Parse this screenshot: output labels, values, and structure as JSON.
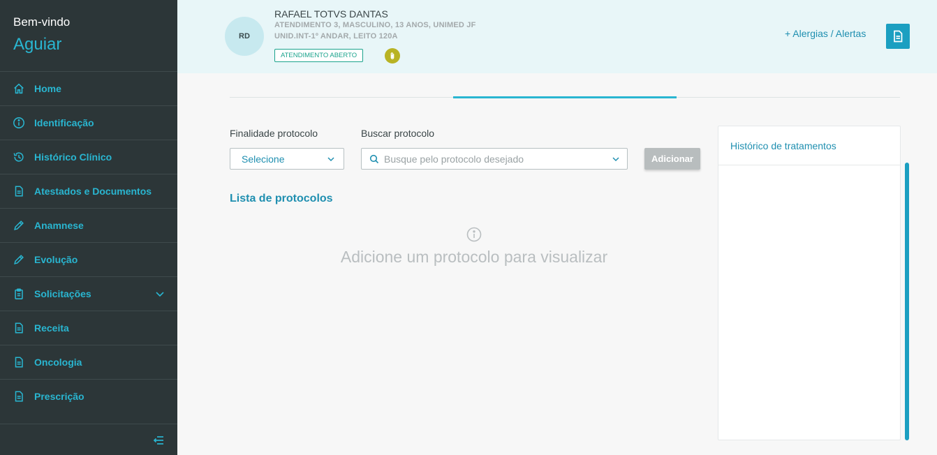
{
  "sidebar": {
    "welcome": "Bem-vindo",
    "user": "Aguiar",
    "items": [
      {
        "label": "Home",
        "icon": "home-icon"
      },
      {
        "label": "Identificação",
        "icon": "info-icon"
      },
      {
        "label": "Histórico Clínico",
        "icon": "history-icon"
      },
      {
        "label": "Atestados e Documentos",
        "icon": "document-icon"
      },
      {
        "label": "Anamnese",
        "icon": "pencil-icon"
      },
      {
        "label": "Evolução",
        "icon": "pencil-icon"
      },
      {
        "label": "Solicitações",
        "icon": "clipboard-icon"
      },
      {
        "label": "Receita",
        "icon": "document-icon"
      },
      {
        "label": "Oncologia",
        "icon": "document-icon"
      },
      {
        "label": "Prescrição",
        "icon": "document-icon"
      }
    ]
  },
  "patient": {
    "initials": "RD",
    "name": "RAFAEL TOTVS DANTAS",
    "details": "ATENDIMENTO 3, MASCULINO, 13 ANOS, UNIMED JF",
    "location": "UNID.INT-1º ANDAR, LEITO 120A",
    "status": "ATENDIMENTO ABERTO"
  },
  "header": {
    "alerts_label": "+ Alergias / Alertas"
  },
  "form": {
    "finalidade_label": "Finalidade protocolo",
    "finalidade_value": "Selecione",
    "buscar_label": "Buscar protocolo",
    "buscar_placeholder": "Busque pelo protocolo desejado",
    "add_label": "Adicionar"
  },
  "list": {
    "title": "Lista de protocolos",
    "empty_message": "Adicione um protocolo para visualizar"
  },
  "history": {
    "title": "Histórico de tratamentos"
  },
  "colors": {
    "sidebar_bg": "#2c3638",
    "accent": "#29b6d1",
    "header_bg": "#e8f6f8",
    "status_green": "#1aa38c"
  }
}
